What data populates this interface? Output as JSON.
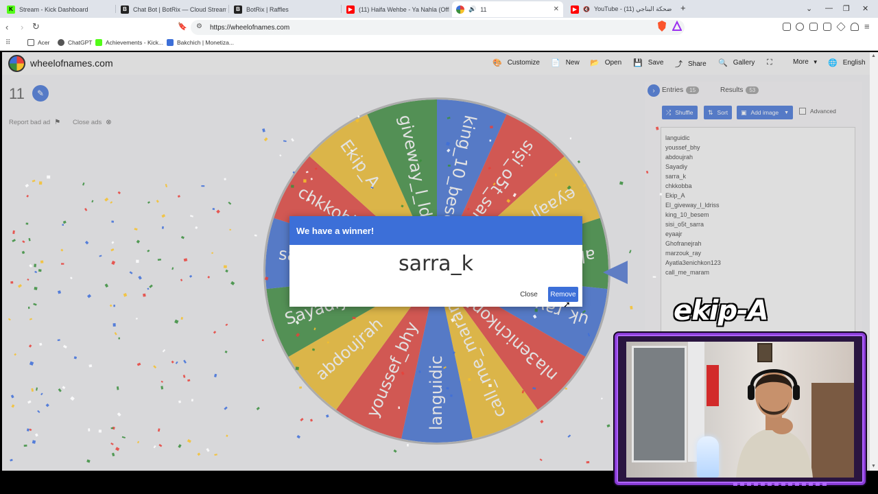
{
  "tabs": [
    {
      "label": "Stream - Kick Dashboard",
      "color": "#53fc18"
    },
    {
      "label": "Chat Bot | BotRix — Cloud Streaming",
      "color": "#222222"
    },
    {
      "label": "BotRix | Raffles",
      "color": "#222222"
    },
    {
      "label": "(11) Haifa Wehbe - Ya Nahla (Official",
      "color": "#ff0000"
    },
    {
      "label": "11",
      "color": "#3c6fd8"
    },
    {
      "label": "YouTube - (11) ضحكة البناجي",
      "color": "#ff0000"
    }
  ],
  "url": "https://wheelofnames.com",
  "bookmarks": [
    "Acer",
    "ChatGPT",
    "Achievements - Kick...",
    "Bakchich | Monetiza..."
  ],
  "site": {
    "name": "wheelofnames.com",
    "menu": [
      "Customize",
      "New",
      "Open",
      "Save",
      "Share",
      "Gallery",
      "More",
      "English"
    ]
  },
  "wheel_title": "11",
  "ad_links": {
    "report": "Report bad ad",
    "close": "Close ads"
  },
  "panel": {
    "entries_tab": "Entries",
    "entries_count": "15",
    "results_tab": "Results",
    "results_count": "53",
    "shuffle": "Shuffle",
    "sort": "Sort",
    "add_image": "Add image",
    "advanced": "Advanced"
  },
  "entries": [
    "languidic",
    "youssef_bhy",
    "abdoujrah",
    "Sayadiy",
    "sarra_k",
    "chkkobba",
    "Ekip_A",
    "El_giveway_l_ldriss",
    "king_10_besem",
    "sisi_o5t_sarra",
    "eyaajr",
    "Ghofranejrah",
    "marzouk_ray",
    "Ayatla3enichkon123",
    "call_me_maram"
  ],
  "wheel_labels": [
    "languidic",
    "youssef_bhy",
    "abdoujrah",
    "Sayadiy",
    "sarra_k",
    "chkkobba",
    "Ekip_A",
    "giveway_l_ldri",
    "king_10_besem",
    "sisi_o5t_sarra",
    "eyaajr",
    "ak",
    "uk_ray",
    "nla3enichkon123",
    "call_me_maram"
  ],
  "wheel_colors": [
    "#3e6fd8",
    "#e8413a",
    "#f6c12b",
    "#3a8e3c"
  ],
  "modal": {
    "title": "We have a winner!",
    "winner": "sarra_k",
    "close": "Close",
    "remove": "Remove"
  },
  "overlay_text": "ekip-A"
}
